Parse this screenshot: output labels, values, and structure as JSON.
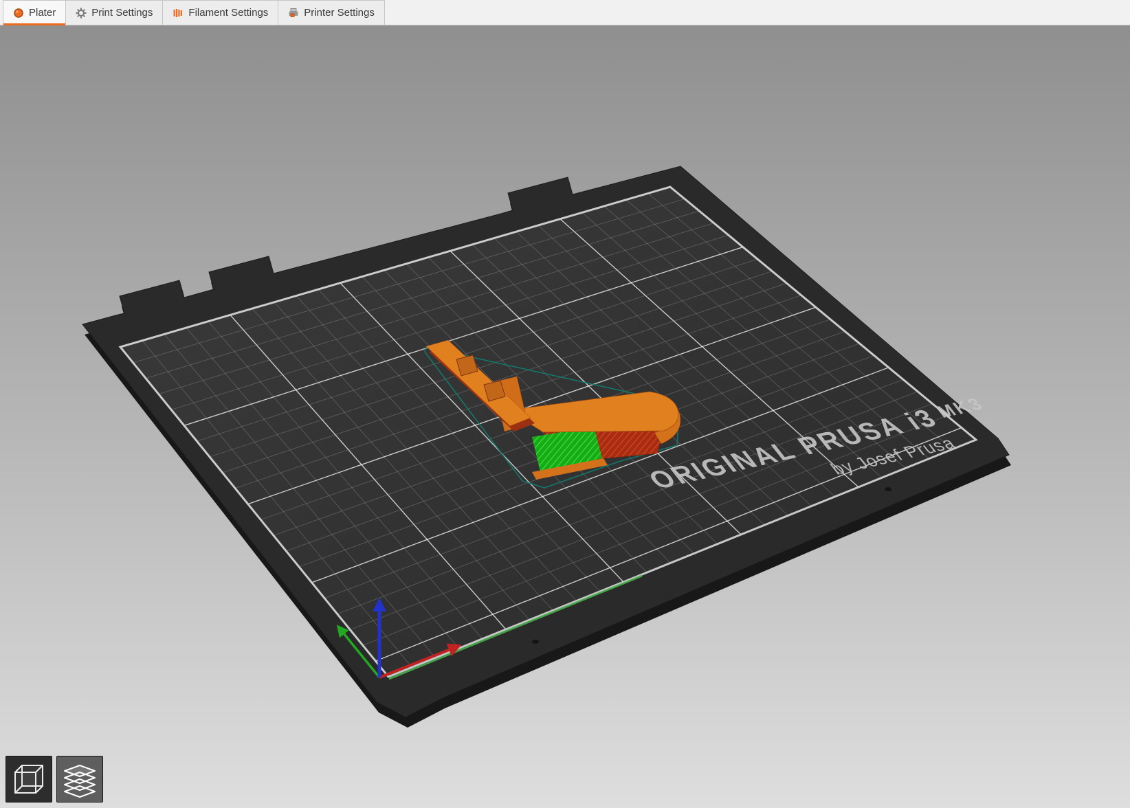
{
  "tabs": [
    {
      "label": "Plater",
      "icon": "plater-icon",
      "active": true
    },
    {
      "label": "Print Settings",
      "icon": "gear-icon",
      "active": false
    },
    {
      "label": "Filament Settings",
      "icon": "filament-icon",
      "active": false
    },
    {
      "label": "Printer Settings",
      "icon": "printer-icon",
      "active": false
    }
  ],
  "bed": {
    "brand_main": "ORIGINAL PRUSA i3",
    "brand_model": "MK3",
    "brand_sub": "by Josef Prusa"
  },
  "view_controls": {
    "buttons": [
      {
        "name": "3d-view"
      },
      {
        "name": "layers-view"
      }
    ]
  },
  "colors": {
    "accent": "#ED6B21",
    "background_top": "#8F8F8F",
    "background_bottom": "#DEDEDE",
    "bed_plate": "#2A2A2A",
    "grid_minor": "#BEBEBE",
    "grid_major": "#FFFFFF",
    "frame": "#CFCFCF",
    "model_orange": "#E0801E",
    "model_infill_red": "#A82C12",
    "support_green": "#17AB17",
    "hull_teal": "#0D8070",
    "axis_x_red": "#C22222",
    "axis_y_green": "#22A822",
    "axis_z_blue": "#2233CC"
  }
}
